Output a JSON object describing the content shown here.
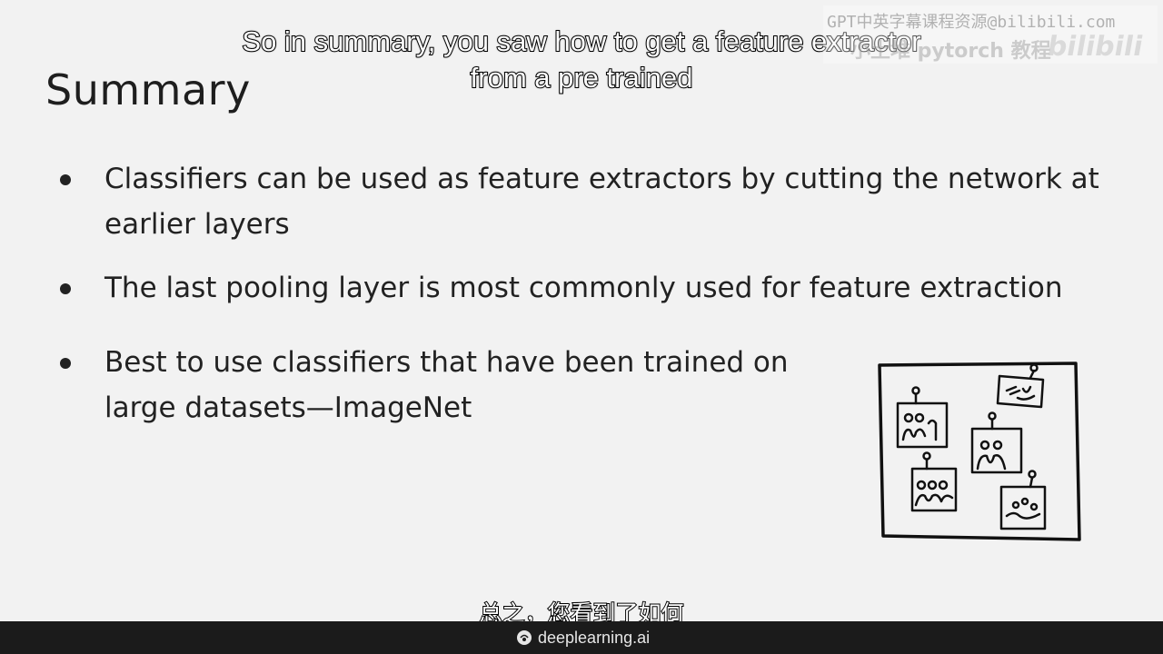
{
  "slide": {
    "title": "Summary",
    "bullets": [
      "Classifiers can be used as feature extractors by cutting the network at earlier layers",
      "The last pooling layer is most commonly used for feature extraction",
      "Best to use classifiers that have been trained on large datasets—ImageNet"
    ],
    "illustration_icon": "framed-board-of-photos-illustration"
  },
  "captions": {
    "english": "So in summary, you saw how to get a feature extractor from a pre trained",
    "chinese": "总之，您看到了如何"
  },
  "watermark": {
    "line1": "GPT中英字幕课程资源@bilibili.com",
    "line2": "小土堆 pytorch 教程",
    "logo": "bilibili"
  },
  "footer": {
    "brand_icon": "deeplearning-logo-icon",
    "brand": "deeplearning.ai"
  }
}
